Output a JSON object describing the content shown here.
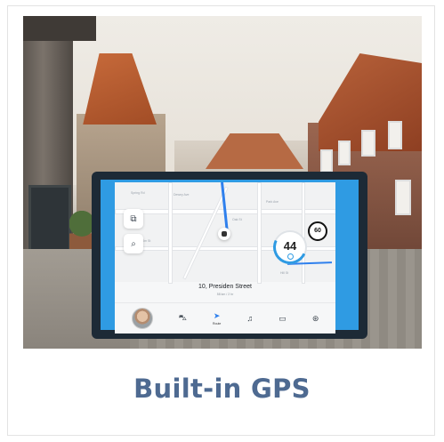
{
  "caption": "Built-in GPS",
  "device": {
    "map_labels": [
      "Spring Rd",
      "Dewey Ave",
      "Park Ave",
      "Elm St",
      "Oak St",
      "Hill St"
    ],
    "speed": "44",
    "speed_limit": "60",
    "destination": "10, Presiden Street",
    "trip_info": "58 km / 2 hr",
    "nav": [
      {
        "icon": "avatar",
        "label": ""
      },
      {
        "icon": "car-icon",
        "label": ""
      },
      {
        "icon": "navigation-icon",
        "label": "Route"
      },
      {
        "icon": "music-icon",
        "label": ""
      },
      {
        "icon": "phone-icon",
        "label": ""
      },
      {
        "icon": "settings-icon",
        "label": ""
      }
    ],
    "map_buttons": [
      "layers-icon",
      "search-icon"
    ]
  },
  "colors": {
    "caption": "#4e6a91",
    "accent": "#2f9be3",
    "route": "#2f80ed"
  }
}
